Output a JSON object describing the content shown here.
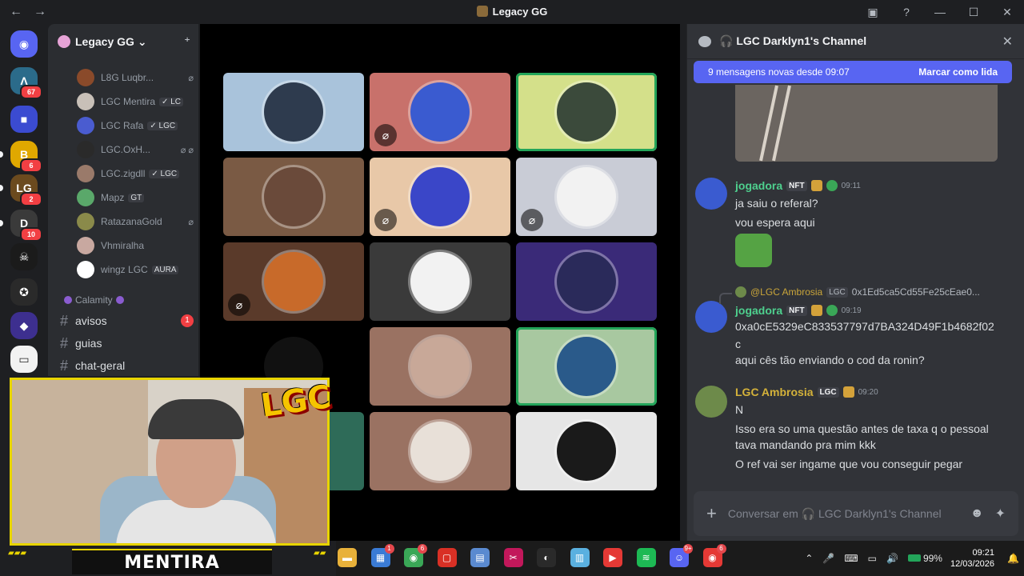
{
  "window": {
    "title": "Legacy GG",
    "back_glyph": "←",
    "fwd_glyph": "→",
    "inbox_glyph": "▣",
    "help_glyph": "?",
    "min_glyph": "—",
    "max_glyph": "☐",
    "close_glyph": "✕"
  },
  "servers": [
    {
      "name": "discord-home-icon",
      "glyph": "◉",
      "color": "#5865f2"
    },
    {
      "name": "server-1",
      "glyph": "Λ",
      "color": "#2b6b8a",
      "badge": "67"
    },
    {
      "name": "server-folder",
      "glyph": "■",
      "color": "#3b4bd1"
    },
    {
      "name": "server-b",
      "glyph": "B",
      "color": "#e0a800",
      "badge": "6"
    },
    {
      "name": "server-legacy",
      "glyph": "LG",
      "color": "#6b4a1e",
      "badge": "2"
    },
    {
      "name": "server-dont",
      "glyph": "D",
      "color": "#3a3a3a",
      "badge": "10"
    },
    {
      "name": "server-skull",
      "glyph": "☠",
      "color": "#1b1b1b"
    },
    {
      "name": "server-wheel",
      "glyph": "✪",
      "color": "#2a2a2a"
    },
    {
      "name": "server-crystal",
      "glyph": "◆",
      "color": "#3d2f8f"
    },
    {
      "name": "server-white",
      "glyph": "▭",
      "color": "#f2f2f2"
    }
  ],
  "sidebar": {
    "guild_name": "Legacy GG",
    "chevron": "⌄",
    "invite_glyph": "⁺",
    "voice_users": [
      {
        "name": "L8G Luqbr...",
        "tag": "",
        "muted": "⌀",
        "avatar": "#8a4a2a"
      },
      {
        "name": "LGC Mentira",
        "tag": "✓ LC",
        "muted": "",
        "avatar": "#c8c0b8"
      },
      {
        "name": "LGC Rafa",
        "tag": "✓ LGC",
        "muted": "",
        "avatar": "#4a5cd0"
      },
      {
        "name": "LGC.OxH...",
        "tag": "",
        "muted": "⌀ ⌀",
        "avatar": "#2a2a2a"
      },
      {
        "name": "LGC.zigdll",
        "tag": "✓ LGC",
        "muted": "",
        "avatar": "#9a7a6a"
      },
      {
        "name": "Mapz",
        "tag": "GT",
        "muted": "",
        "avatar": "#5aa86a"
      },
      {
        "name": "RatazanaGold",
        "tag": "",
        "muted": "⌀",
        "avatar": "#8a8a4a"
      },
      {
        "name": "Vhmiralha",
        "tag": "",
        "muted": "",
        "avatar": "#c8a8a0"
      },
      {
        "name": "wingz LGC",
        "tag": "AURA",
        "muted": "",
        "avatar": "#ffffff"
      }
    ],
    "category": "Calamity",
    "channels": [
      {
        "name": "avisos",
        "badge": "1"
      },
      {
        "name": "guias",
        "badge": ""
      },
      {
        "name": "chat-geral",
        "badge": ""
      }
    ]
  },
  "voice_tiles": [
    {
      "bg": "#a9c3db",
      "avatar": "#2e3b4e",
      "muted": false,
      "speaking": false
    },
    {
      "bg": "#c8716b",
      "avatar": "#3a5bd0",
      "muted": true,
      "speaking": false
    },
    {
      "bg": "#d4e08a",
      "avatar": "#3b4a3b",
      "muted": false,
      "speaking": true
    },
    {
      "bg": "#7a5a44",
      "avatar": "#6a4a3a",
      "muted": false,
      "speaking": false
    },
    {
      "bg": "#e8c8a8",
      "avatar": "#3a46c8",
      "muted": true,
      "speaking": false
    },
    {
      "bg": "#c9ccd6",
      "avatar": "#f2f2f2",
      "muted": true,
      "speaking": false
    },
    {
      "bg": "#5a3a2a",
      "avatar": "#c86a2a",
      "muted": true,
      "speaking": false
    },
    {
      "bg": "#3a3a3a",
      "avatar": "#f2f2f2",
      "muted": false,
      "speaking": false
    },
    {
      "bg": "#3a2a78",
      "avatar": "#2a2a5a",
      "muted": false,
      "speaking": false
    },
    {
      "bg": "#000000",
      "avatar": "#111111",
      "muted": false,
      "speaking": false
    },
    {
      "bg": "#9a7262",
      "avatar": "#c8a898",
      "muted": false,
      "speaking": false
    },
    {
      "bg": "#a8c8a0",
      "avatar": "#2a5a8a",
      "muted": false,
      "speaking": true
    },
    {
      "bg": "#2e6b58",
      "avatar": "#2e6b58",
      "muted": false,
      "speaking": false
    },
    {
      "bg": "#9a7262",
      "avatar": "#e8e0d8",
      "muted": false,
      "speaking": false
    },
    {
      "bg": "#e6e6e6",
      "avatar": "#1a1a1a",
      "muted": false,
      "speaking": false
    }
  ],
  "mute_glyph": "⌀",
  "webcam": {
    "logo": "LGC",
    "name": "MENTIRA"
  },
  "chat": {
    "channel_name": "🎧 LGC Darklyn1's Channel",
    "close_glyph": "✕",
    "new_messages": "9 mensagens novas desde 09:07",
    "mark_read": "Marcar como lida",
    "messages": [
      {
        "author": "jogadora",
        "color": "#4ed08e",
        "tag": "NFT",
        "time": "09:11",
        "lines": [
          "ja saiu o referal?",
          "vou espera aqui"
        ]
      },
      {
        "author": "jogadora",
        "color": "#4ed08e",
        "tag": "NFT",
        "time": "09:19",
        "reply_author": "@LGC Ambrosia",
        "reply_tag": "LGC",
        "reply_text": "0x1Ed5ca5Cd55Fe25cEae0...",
        "lines": [
          "0xa0cE5329eC833537797d7BA324D49F1b4682f02",
          "c",
          " aqui cês tão enviando o cod da ronin?"
        ]
      },
      {
        "author": "LGC Ambrosia",
        "color": "#d4b23a",
        "tag": "LGC",
        "time": "09:20",
        "lines": [
          "N",
          "Isso era so uma questão antes de taxa q o pessoal",
          "tava mandando pra mim kkk",
          "O ref vai ser ingame que vou conseguir pegar"
        ]
      }
    ],
    "composer_placeholder": "Conversar em 🎧 LGC Darklyn1's Channel",
    "plus_glyph": "+",
    "emoji_glyph": "☻",
    "apps_glyph": "✦"
  },
  "taskbar": {
    "apps": [
      {
        "name": "file-explorer-icon",
        "glyph": "▬",
        "color": "#e8b13a",
        "badge": ""
      },
      {
        "name": "store-icon",
        "glyph": "▦",
        "color": "#3a7bd5",
        "badge": "1"
      },
      {
        "name": "chrome-icon",
        "glyph": "◉",
        "color": "#3aa757",
        "badge": "6"
      },
      {
        "name": "app-red-icon",
        "glyph": "▢",
        "color": "#d93025",
        "badge": ""
      },
      {
        "name": "calculator-icon",
        "glyph": "▤",
        "color": "#5a8ad0",
        "badge": ""
      },
      {
        "name": "snipping-icon",
        "glyph": "✂",
        "color": "#c2185b",
        "badge": ""
      },
      {
        "name": "obs-icon",
        "glyph": "◐",
        "color": "#2a2a2a",
        "badge": ""
      },
      {
        "name": "notepad-icon",
        "glyph": "▥",
        "color": "#5ab0e0",
        "badge": ""
      },
      {
        "name": "media-player-icon",
        "glyph": "▶",
        "color": "#e53935",
        "badge": ""
      },
      {
        "name": "spotify-icon",
        "glyph": "≋",
        "color": "#1db954",
        "badge": ""
      },
      {
        "name": "discord-icon",
        "glyph": "☺",
        "color": "#5865f2",
        "badge": "9+"
      },
      {
        "name": "chrome-profile-icon",
        "glyph": "◉",
        "color": "#e53935",
        "badge": "6"
      }
    ],
    "tray_chevron": "⌃",
    "mic_glyph": "🎤",
    "kbd_glyph": "⌨",
    "display_glyph": "▭",
    "volume_glyph": "🔊",
    "battery": "99%",
    "time": "09:21",
    "date": "12/03/2026",
    "notif_glyph": "🔔"
  }
}
